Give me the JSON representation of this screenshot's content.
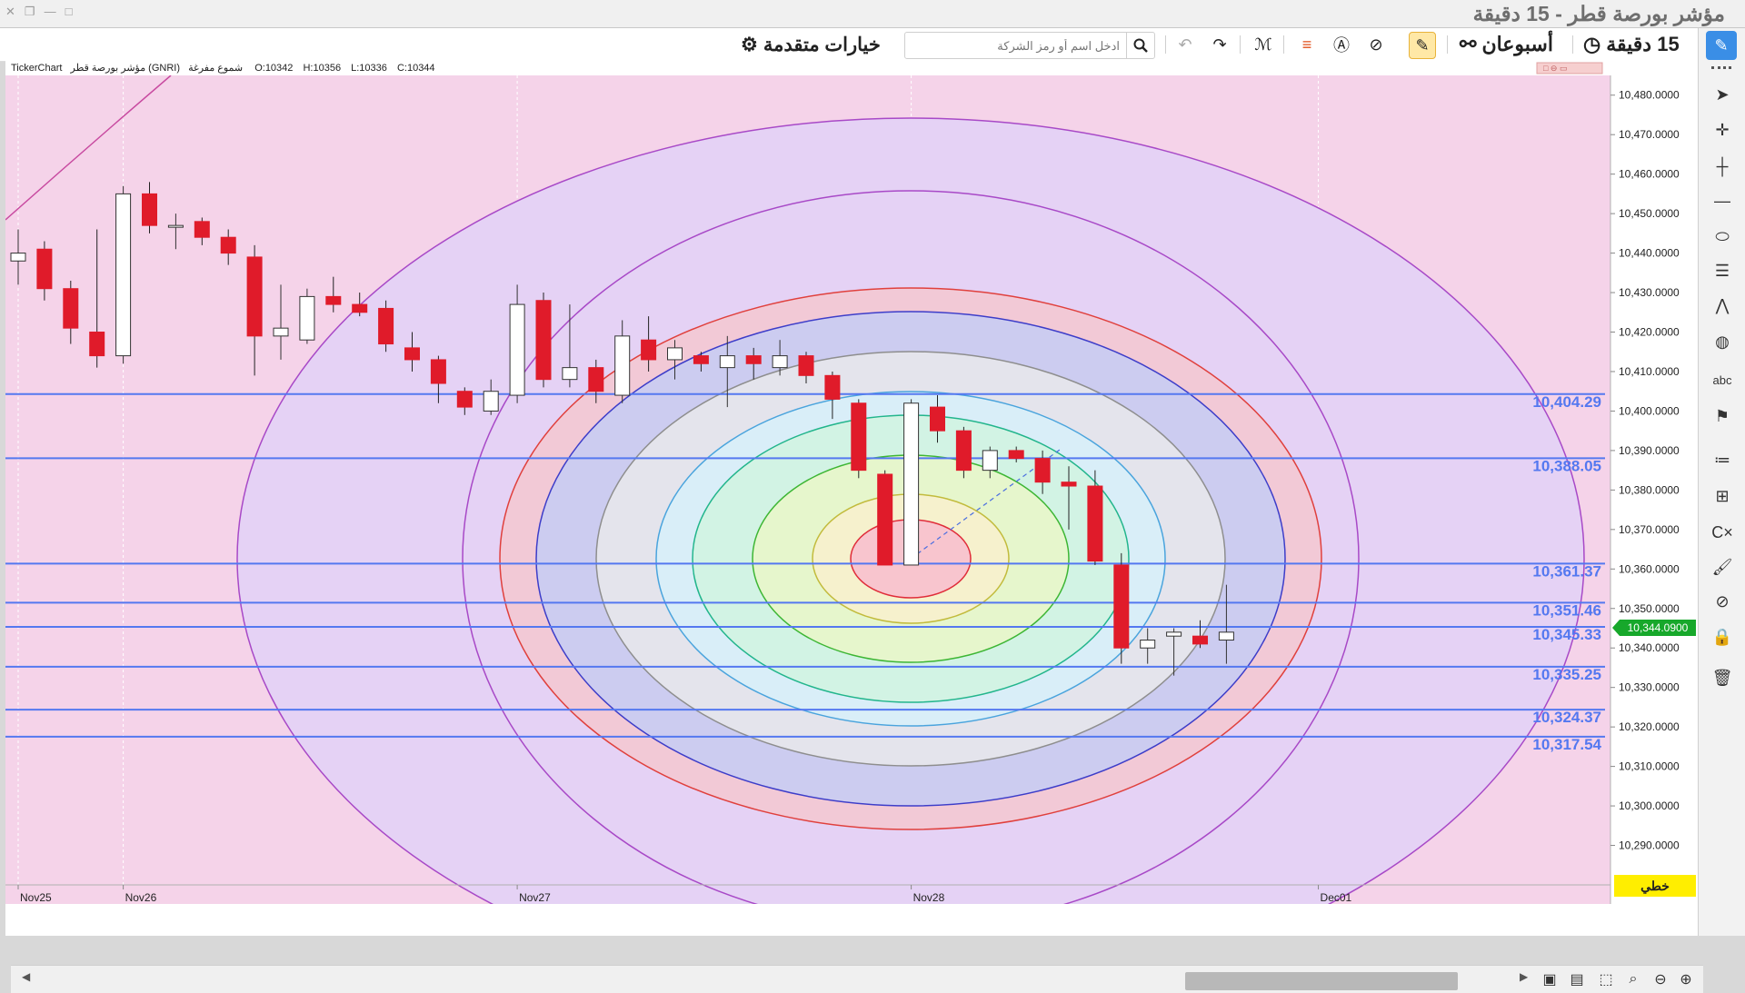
{
  "window": {
    "title": "مؤشر بورصة قطر - 15 دقيقة"
  },
  "toolbar": {
    "advanced_options": "خيارات متقدمة",
    "search_placeholder": "ادخل اسم أو رمز الشركة",
    "period_range": "أسبوعان",
    "interval": "15 دقيقة"
  },
  "chart_header": {
    "source": "TickerChart",
    "symbol": "مؤشر بورصة قطر (GNRI)",
    "style": "شموع مفرغة",
    "open": "O:10342",
    "high": "H:10356",
    "low": "L:10336",
    "close": "C:10344"
  },
  "price_tag": "10,344.0900",
  "mode_label": "خطي",
  "colors": {
    "up": "#ffffff",
    "down": "#e01b2a",
    "fib_line": "#5478f0",
    "accent": "#3a8ee6",
    "price_tag_bg": "#17a82b",
    "mode_bg": "#ffee00"
  },
  "chart_data": {
    "type": "candlestick",
    "y_axis": {
      "ticks": [
        "10,480.0000",
        "10,470.0000",
        "10,460.0000",
        "10,450.0000",
        "10,440.0000",
        "10,430.0000",
        "10,420.0000",
        "10,410.0000",
        "10,400.0000",
        "10,390.0000",
        "10,380.0000",
        "10,370.0000",
        "10,360.0000",
        "10,350.0000",
        "10,340.0000",
        "10,330.0000",
        "10,320.0000",
        "10,310.0000",
        "10,300.0000",
        "10,290.0000"
      ],
      "range": [
        10280,
        10485
      ]
    },
    "x_axis": {
      "labels": [
        "Nov25",
        "Nov26",
        "Nov27",
        "Nov28",
        "Dec01"
      ],
      "label_candle_index": [
        0,
        4,
        19,
        34,
        49.5
      ]
    },
    "fib_levels": [
      "10,404.29",
      "10,388.05",
      "10,361.37",
      "10,351.46",
      "10,345.33",
      "10,335.25",
      "10,324.37",
      "10,317.54"
    ],
    "candles": [
      {
        "o": 10438,
        "h": 10446,
        "l": 10432,
        "c": 10440
      },
      {
        "o": 10441,
        "h": 10443,
        "l": 10428,
        "c": 10431
      },
      {
        "o": 10431,
        "h": 10433,
        "l": 10417,
        "c": 10421
      },
      {
        "o": 10420,
        "h": 10446,
        "l": 10411,
        "c": 10414
      },
      {
        "o": 10414,
        "h": 10457,
        "l": 10412,
        "c": 10455
      },
      {
        "o": 10455,
        "h": 10458,
        "l": 10445,
        "c": 10447
      },
      {
        "o": 10447,
        "h": 10450,
        "l": 10441,
        "c": 10447
      },
      {
        "o": 10448,
        "h": 10449,
        "l": 10442,
        "c": 10444
      },
      {
        "o": 10444,
        "h": 10446,
        "l": 10437,
        "c": 10440
      },
      {
        "o": 10439,
        "h": 10442,
        "l": 10409,
        "c": 10419
      },
      {
        "o": 10419,
        "h": 10432,
        "l": 10413,
        "c": 10421
      },
      {
        "o": 10418,
        "h": 10431,
        "l": 10417,
        "c": 10429
      },
      {
        "o": 10429,
        "h": 10434,
        "l": 10425,
        "c": 10427
      },
      {
        "o": 10427,
        "h": 10430,
        "l": 10424,
        "c": 10425
      },
      {
        "o": 10426,
        "h": 10428,
        "l": 10415,
        "c": 10417
      },
      {
        "o": 10416,
        "h": 10420,
        "l": 10410,
        "c": 10413
      },
      {
        "o": 10413,
        "h": 10414,
        "l": 10402,
        "c": 10407
      },
      {
        "o": 10405,
        "h": 10406,
        "l": 10399,
        "c": 10401
      },
      {
        "o": 10400,
        "h": 10408,
        "l": 10399,
        "c": 10405
      },
      {
        "o": 10404,
        "h": 10432,
        "l": 10402,
        "c": 10427
      },
      {
        "o": 10428,
        "h": 10430,
        "l": 10406,
        "c": 10408
      },
      {
        "o": 10408,
        "h": 10427,
        "l": 10406,
        "c": 10411
      },
      {
        "o": 10411,
        "h": 10413,
        "l": 10402,
        "c": 10405
      },
      {
        "o": 10404,
        "h": 10423,
        "l": 10402,
        "c": 10419
      },
      {
        "o": 10418,
        "h": 10424,
        "l": 10410,
        "c": 10413
      },
      {
        "o": 10413,
        "h": 10418,
        "l": 10408,
        "c": 10416
      },
      {
        "o": 10414,
        "h": 10415,
        "l": 10410,
        "c": 10412
      },
      {
        "o": 10411,
        "h": 10419,
        "l": 10401,
        "c": 10414
      },
      {
        "o": 10414,
        "h": 10416,
        "l": 10408,
        "c": 10412
      },
      {
        "o": 10411,
        "h": 10418,
        "l": 10409,
        "c": 10414
      },
      {
        "o": 10414,
        "h": 10415,
        "l": 10407,
        "c": 10409
      },
      {
        "o": 10409,
        "h": 10410,
        "l": 10398,
        "c": 10403
      },
      {
        "o": 10402,
        "h": 10403,
        "l": 10383,
        "c": 10385
      },
      {
        "o": 10384,
        "h": 10385,
        "l": 10361,
        "c": 10361
      },
      {
        "o": 10361,
        "h": 10403,
        "l": 10361,
        "c": 10402
      },
      {
        "o": 10401,
        "h": 10404,
        "l": 10392,
        "c": 10395
      },
      {
        "o": 10395,
        "h": 10396,
        "l": 10383,
        "c": 10385
      },
      {
        "o": 10385,
        "h": 10391,
        "l": 10383,
        "c": 10390
      },
      {
        "o": 10390,
        "h": 10391,
        "l": 10387,
        "c": 10388
      },
      {
        "o": 10388,
        "h": 10390,
        "l": 10379,
        "c": 10382
      },
      {
        "o": 10382,
        "h": 10386,
        "l": 10370,
        "c": 10381
      },
      {
        "o": 10381,
        "h": 10385,
        "l": 10361,
        "c": 10362
      },
      {
        "o": 10361,
        "h": 10364,
        "l": 10336,
        "c": 10340
      },
      {
        "o": 10340,
        "h": 10345,
        "l": 10336,
        "c": 10342
      },
      {
        "o": 10343,
        "h": 10345,
        "l": 10333,
        "c": 10344
      },
      {
        "o": 10343,
        "h": 10347,
        "l": 10340,
        "c": 10341
      },
      {
        "o": 10342,
        "h": 10356,
        "l": 10336,
        "c": 10344
      }
    ]
  }
}
